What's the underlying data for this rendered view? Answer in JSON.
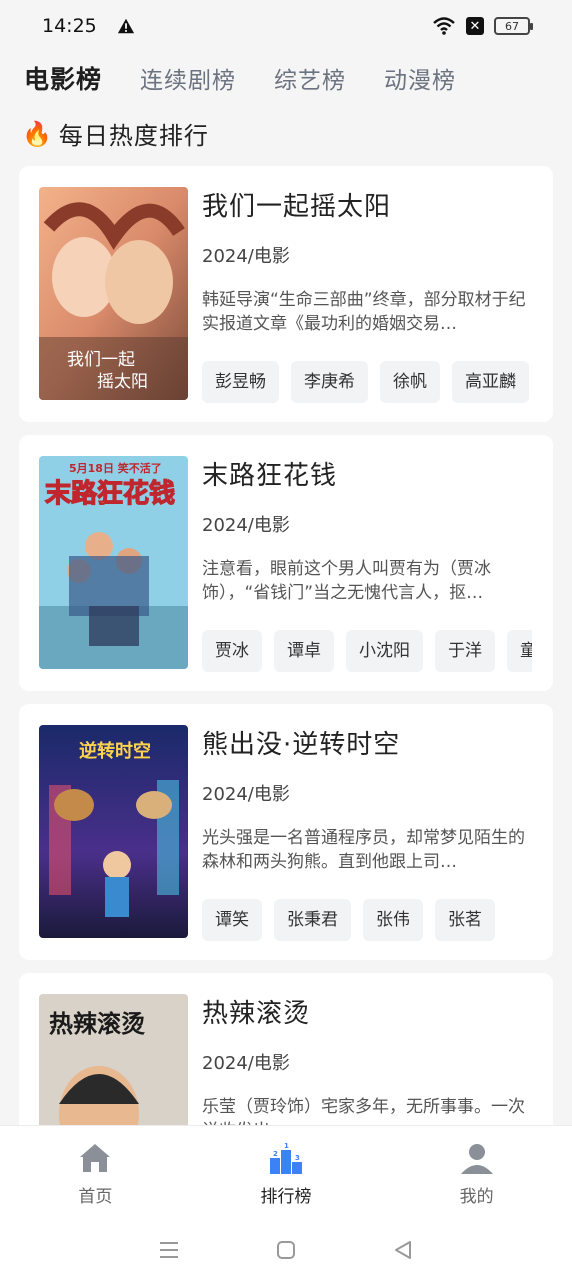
{
  "status": {
    "time": "14:25",
    "battery": "67"
  },
  "tabs": [
    {
      "label": "电影榜",
      "active": true
    },
    {
      "label": "连续剧榜",
      "active": false
    },
    {
      "label": "综艺榜",
      "active": false
    },
    {
      "label": "动漫榜",
      "active": false
    }
  ],
  "section": {
    "icon": "🔥",
    "title": "每日热度排行"
  },
  "movies": [
    {
      "title": "我们一起摇太阳",
      "meta": "2024/电影",
      "desc": "韩延导演“生命三部曲”终章，部分取材于纪实报道文章《最功利的婚姻交易…",
      "cast": [
        "彭昱畅",
        "李庚希",
        "徐帆",
        "高亚麟"
      ],
      "poster_text": "我们一起摇太阳"
    },
    {
      "title": "末路狂花钱",
      "meta": "2024/电影",
      "desc": "注意看，眼前这个男人叫贾有为（贾冰饰），“省钱门”当之无愧代言人，抠…",
      "cast": [
        "贾冰",
        "谭卓",
        "小沈阳",
        "于洋",
        "童"
      ],
      "poster_text": "末路狂花钱",
      "poster_top": "5月18日 笑不活了"
    },
    {
      "title": "熊出没·逆转时空",
      "meta": "2024/电影",
      "desc": "光头强是一名普通程序员，却常梦见陌生的森林和两头狗熊。直到他跟上司…",
      "cast": [
        "谭笑",
        "张秉君",
        "张伟",
        "张茗"
      ],
      "poster_text": "逆转时空"
    },
    {
      "title": "热辣滚烫",
      "meta": "2024/电影",
      "desc": "乐莹（贾玲饰）宅家多年，无所事事。一次说收发出…",
      "cast": [],
      "poster_text": "热辣滚烫"
    }
  ],
  "nav": [
    {
      "label": "首页",
      "icon": "home-icon"
    },
    {
      "label": "排行榜",
      "icon": "podium-icon"
    },
    {
      "label": "我的",
      "icon": "user-icon"
    }
  ]
}
